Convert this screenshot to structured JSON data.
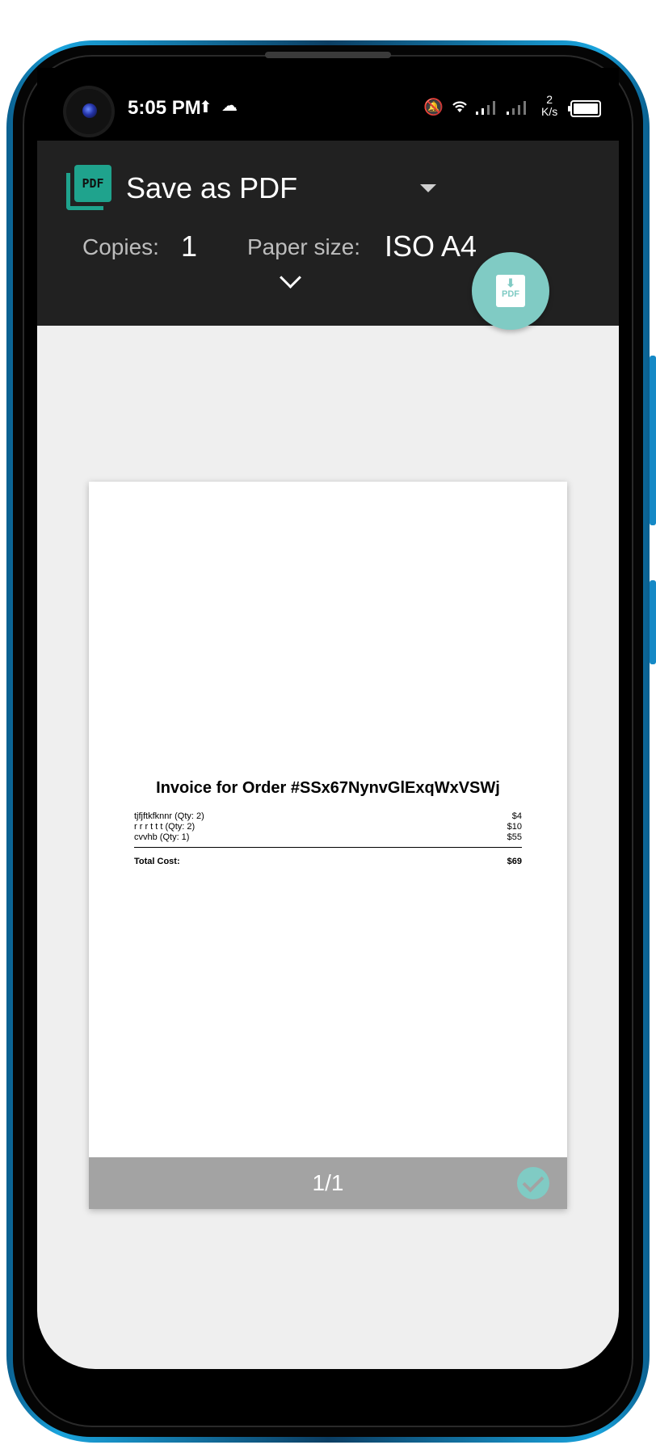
{
  "status_bar": {
    "time": "5:05 PM",
    "net_speed_value": "2",
    "net_speed_unit": "K/s",
    "icons": [
      "upload-icon",
      "cloud-icon",
      "mute-icon",
      "wifi-icon",
      "signal-icon",
      "signal-icon",
      "battery-icon"
    ]
  },
  "print_toolbar": {
    "printer_name": "Save as PDF",
    "copies_label": "Copies:",
    "copies_value": "1",
    "paper_size_label": "Paper size:",
    "paper_size_value": "ISO A4",
    "pdf_logo_text": "PDF",
    "fab_label": "PDF"
  },
  "preview": {
    "invoice_title": "Invoice for Order #SSx67NynvGlExqWxVSWj",
    "items": [
      {
        "name": "tjfjftkfknnr (Qty: 2)",
        "price": "$4"
      },
      {
        "name": "r r r t t t  (Qty: 2)",
        "price": "$10"
      },
      {
        "name": "cvvhb (Qty: 1)",
        "price": "$55"
      }
    ],
    "total_label": "Total Cost:",
    "total_value": "$69",
    "page_indicator": "1/1"
  },
  "colors": {
    "accent": "#80cbc4",
    "toolbar_bg": "#212121",
    "pdf_logo": "#1fa38d",
    "preview_bg": "#efefef"
  }
}
